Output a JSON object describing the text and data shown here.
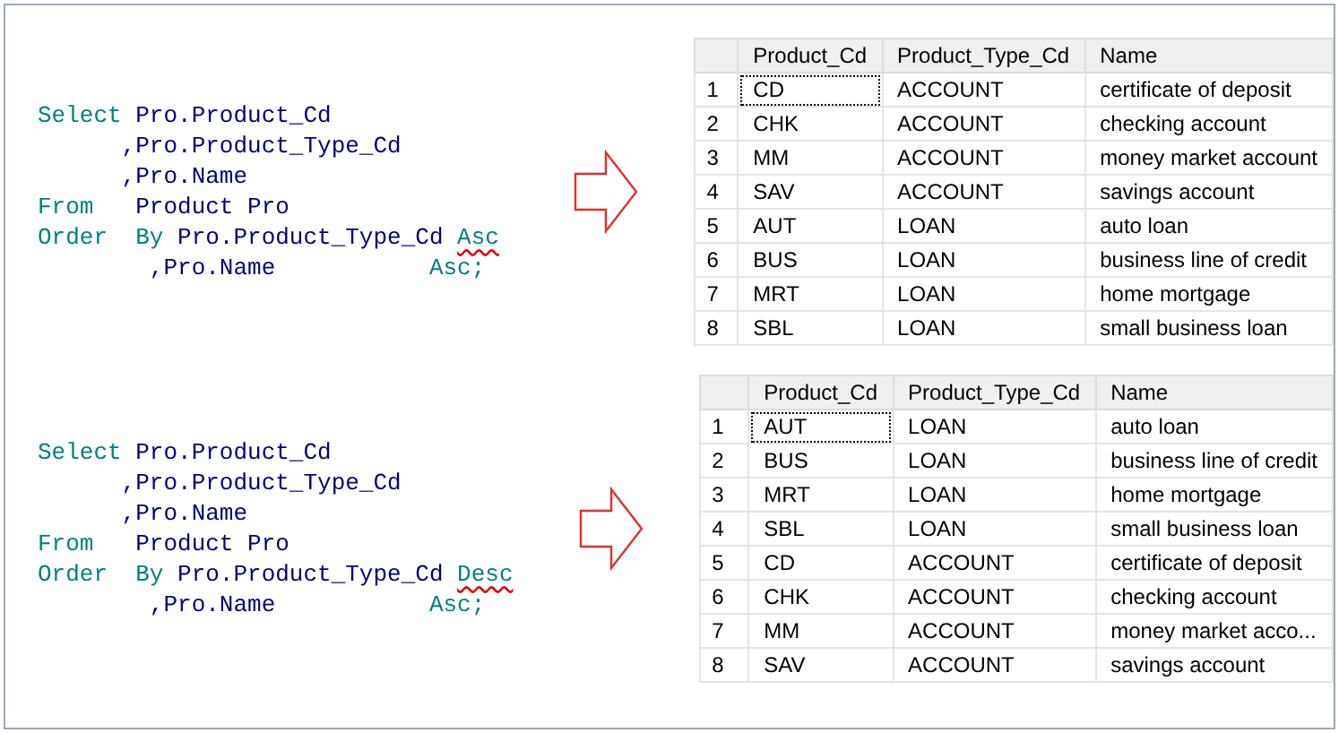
{
  "panels": [
    {
      "query": {
        "lines": [
          [
            {
              "text": "Select",
              "kind": "keyword",
              "squiggle": false
            },
            {
              "text": " Pro.Product_Cd",
              "kind": "ident",
              "squiggle": false
            }
          ],
          [
            {
              "text": "      ,Pro.Product_Type_Cd",
              "kind": "ident",
              "squiggle": false
            }
          ],
          [
            {
              "text": "      ,Pro.Name",
              "kind": "ident",
              "squiggle": false
            }
          ],
          [
            {
              "text": "From",
              "kind": "keyword",
              "squiggle": false
            },
            {
              "text": "   Product Pro",
              "kind": "ident",
              "squiggle": false
            }
          ],
          [
            {
              "text": "Order  By",
              "kind": "keyword",
              "squiggle": false
            },
            {
              "text": " Pro.Product_Type_Cd ",
              "kind": "ident",
              "squiggle": false
            },
            {
              "text": "Asc",
              "kind": "keyword",
              "squiggle": true
            }
          ],
          [
            {
              "text": "        ,Pro.Name",
              "kind": "ident",
              "squiggle": false
            },
            {
              "text": "           Asc;",
              "kind": "keyword",
              "squiggle": false
            }
          ]
        ]
      },
      "grid": {
        "columns": [
          "Product_Cd",
          "Product_Type_Cd",
          "Name"
        ],
        "rows": [
          {
            "num": "1",
            "cells": [
              "CD",
              "ACCOUNT",
              "certificate of deposit"
            ],
            "focused": true
          },
          {
            "num": "2",
            "cells": [
              "CHK",
              "ACCOUNT",
              "checking account"
            ],
            "focused": false
          },
          {
            "num": "3",
            "cells": [
              "MM",
              "ACCOUNT",
              "money market account"
            ],
            "focused": false
          },
          {
            "num": "4",
            "cells": [
              "SAV",
              "ACCOUNT",
              "savings account"
            ],
            "focused": false
          },
          {
            "num": "5",
            "cells": [
              "AUT",
              "LOAN",
              "auto loan"
            ],
            "focused": false
          },
          {
            "num": "6",
            "cells": [
              "BUS",
              "LOAN",
              "business line of credit"
            ],
            "focused": false
          },
          {
            "num": "7",
            "cells": [
              "MRT",
              "LOAN",
              "home mortgage"
            ],
            "focused": false
          },
          {
            "num": "8",
            "cells": [
              "SBL",
              "LOAN",
              "small business loan"
            ],
            "focused": false
          }
        ]
      }
    },
    {
      "query": {
        "lines": [
          [
            {
              "text": "Select",
              "kind": "keyword",
              "squiggle": false
            },
            {
              "text": " Pro.Product_Cd",
              "kind": "ident",
              "squiggle": false
            }
          ],
          [
            {
              "text": "      ,Pro.Product_Type_Cd",
              "kind": "ident",
              "squiggle": false
            }
          ],
          [
            {
              "text": "      ,Pro.Name",
              "kind": "ident",
              "squiggle": false
            }
          ],
          [
            {
              "text": "From",
              "kind": "keyword",
              "squiggle": false
            },
            {
              "text": "   Product Pro",
              "kind": "ident",
              "squiggle": false
            }
          ],
          [
            {
              "text": "Order  By",
              "kind": "keyword",
              "squiggle": false
            },
            {
              "text": " Pro.Product_Type_Cd ",
              "kind": "ident",
              "squiggle": false
            },
            {
              "text": "Desc",
              "kind": "keyword",
              "squiggle": true
            }
          ],
          [
            {
              "text": "        ,Pro.Name",
              "kind": "ident",
              "squiggle": false
            },
            {
              "text": "           Asc;",
              "kind": "keyword",
              "squiggle": false
            }
          ]
        ]
      },
      "grid": {
        "columns": [
          "Product_Cd",
          "Product_Type_Cd",
          "Name"
        ],
        "rows": [
          {
            "num": "1",
            "cells": [
              "AUT",
              "LOAN",
              "auto loan"
            ],
            "focused": true
          },
          {
            "num": "2",
            "cells": [
              "BUS",
              "LOAN",
              "business line of credit"
            ],
            "focused": false
          },
          {
            "num": "3",
            "cells": [
              "MRT",
              "LOAN",
              "home mortgage"
            ],
            "focused": false
          },
          {
            "num": "4",
            "cells": [
              "SBL",
              "LOAN",
              "small business loan"
            ],
            "focused": false
          },
          {
            "num": "5",
            "cells": [
              "CD",
              "ACCOUNT",
              "certificate of deposit"
            ],
            "focused": false
          },
          {
            "num": "6",
            "cells": [
              "CHK",
              "ACCOUNT",
              "checking account"
            ],
            "focused": false
          },
          {
            "num": "7",
            "cells": [
              "MM",
              "ACCOUNT",
              "money market acco..."
            ],
            "focused": false
          },
          {
            "num": "8",
            "cells": [
              "SAV",
              "ACCOUNT",
              "savings account"
            ],
            "focused": false
          }
        ]
      }
    }
  ]
}
